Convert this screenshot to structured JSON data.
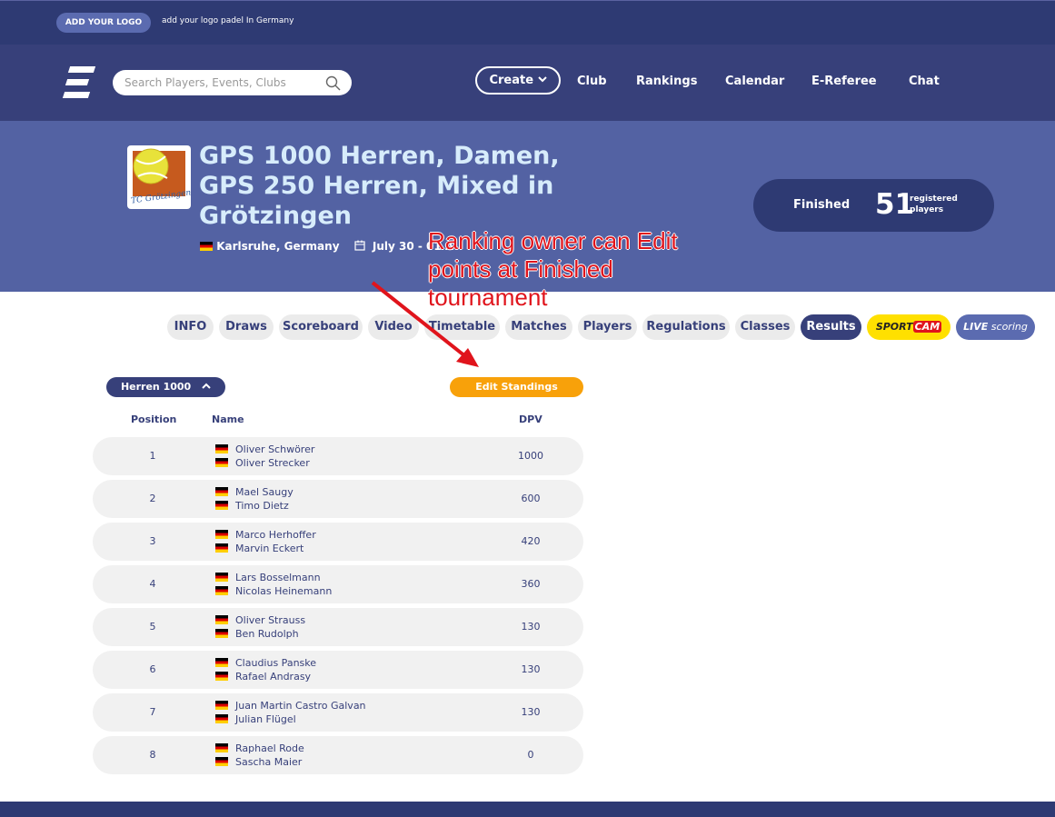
{
  "topbar": {
    "logo_button": "ADD YOUR LOGO",
    "note": "add your logo padel In Germany"
  },
  "nav": {
    "search_placeholder": "Search Players, Events, Clubs",
    "create": "Create",
    "links": [
      "Club",
      "Rankings",
      "Calendar",
      "E-Referee",
      "Chat"
    ]
  },
  "tournament": {
    "title": "GPS 1000 Herren, Damen, GPS 250 Herren, Mixed in Grötzingen",
    "club_logo_text": "TC Grötzingen",
    "location": "Karlsruhe, Germany",
    "dates": "July 30 - 01 A",
    "status": "Finished",
    "registered_count": "51",
    "registered_label": "registered players"
  },
  "annotation": "Ranking owner can Edit points at Finished tournament",
  "tabs": [
    "INFO",
    "Draws",
    "Scoreboard",
    "Video",
    "Timetable",
    "Matches",
    "Players",
    "Regulations",
    "Classes",
    "Results"
  ],
  "tab_sportcam": {
    "a": "SPORT",
    "b": "CAM"
  },
  "tab_live": {
    "a": "LIVE",
    "b": " scoring"
  },
  "standings": {
    "class_name": "Herren 1000",
    "edit_button": "Edit Standings",
    "headers": {
      "position": "Position",
      "name": "Name",
      "points": "DPV"
    },
    "rows": [
      {
        "position": "1",
        "player1": "Oliver Schwörer",
        "player2": "Oliver Strecker",
        "points": "1000"
      },
      {
        "position": "2",
        "player1": "Mael Saugy",
        "player2": "Timo Dietz",
        "points": "600"
      },
      {
        "position": "3",
        "player1": "Marco Herhoffer",
        "player2": "Marvin Eckert",
        "points": "420"
      },
      {
        "position": "4",
        "player1": "Lars Bosselmann",
        "player2": "Nicolas Heinemann",
        "points": "360"
      },
      {
        "position": "5",
        "player1": "Oliver Strauss",
        "player2": "Ben Rudolph",
        "points": "130"
      },
      {
        "position": "6",
        "player1": "Claudius Panske",
        "player2": "Rafael Andrasy",
        "points": "130"
      },
      {
        "position": "7",
        "player1": "Juan Martin Castro Galvan",
        "player2": "Julian Flügel",
        "points": "130"
      },
      {
        "position": "8",
        "player1": "Raphael Rode",
        "player2": "Sascha Maier",
        "points": "0"
      }
    ]
  },
  "colors": {
    "navy": "#2e3a73",
    "nav": "#37407a",
    "hero": "#5362a3",
    "accent_orange": "#f8a10a",
    "annotation_red": "#e0141c"
  }
}
